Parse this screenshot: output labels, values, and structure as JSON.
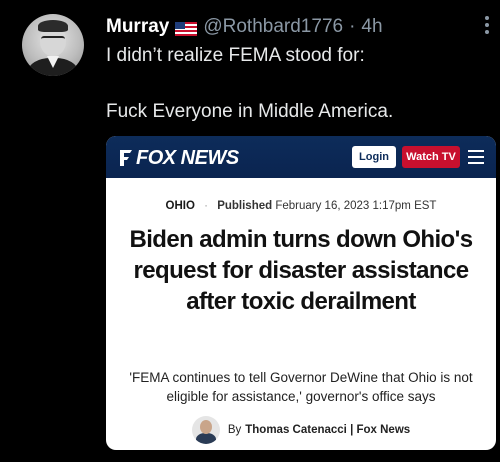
{
  "tweet": {
    "display_name": "Murray",
    "flag_icon": "us-flag-icon",
    "handle": "@Rothbard1776",
    "separator": "·",
    "time": "4h",
    "text_line1": "I didn’t realize FEMA stood for:",
    "text_line2": "Fuck Everyone in Middle America."
  },
  "article": {
    "brand": "FOX NEWS",
    "login_label": "Login",
    "watch_label": "Watch TV",
    "section": "OHIO",
    "dot": "·",
    "published_label": "Published",
    "published_date": "February 16, 2023 1:17pm EST",
    "headline": "Biden admin turns down Ohio's request for disaster assistance after toxic derailment",
    "subheadline": "'FEMA continues to tell Governor DeWine that Ohio is not eligible for assistance,' governor's office says",
    "by_label": "By",
    "author": "Thomas Catenacci | Fox News"
  },
  "colors": {
    "background": "#000000",
    "fox_navy": "#0d2c5a",
    "watch_red": "#c8102e",
    "muted": "#8b98a5"
  }
}
